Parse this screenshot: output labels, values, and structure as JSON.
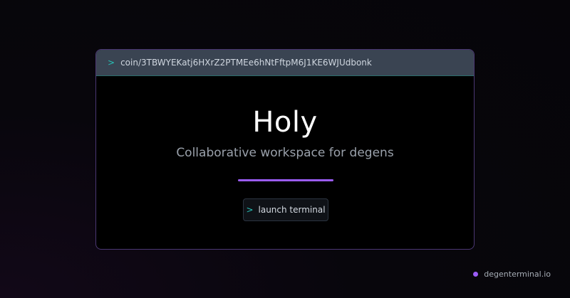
{
  "terminal": {
    "prompt_symbol": ">",
    "path": "coin/3TBWYEKatj6HXrZ2PTMEe6hNtFftpM6J1KE6WJUdbonk"
  },
  "hero": {
    "title": "Holy",
    "subtitle": "Collaborative workspace for degens"
  },
  "launch_button": {
    "prompt_symbol": ">",
    "label": "launch terminal"
  },
  "footer": {
    "domain": "degenterminal.io"
  },
  "colors": {
    "accent": "#9b5cf6",
    "prompt": "#27c1b6",
    "titlebar": "#3a4452",
    "border": "#4b3773"
  }
}
